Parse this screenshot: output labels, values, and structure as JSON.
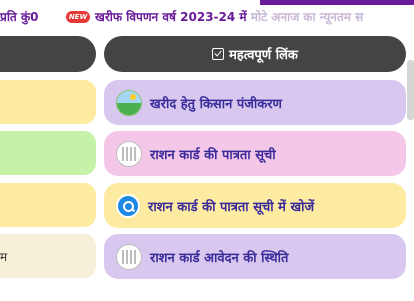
{
  "ticker": {
    "partial_text": "प्रति कुं0",
    "new_badge": "NEW",
    "headline": "खरीफ विपणन वर्ष 2023-24 में ",
    "headline_faded": "मोटे अनाज का न्यूनतम स"
  },
  "left_column": {
    "visible_text_row4": "म"
  },
  "links_section": {
    "header_label": "महत्वपूर्ण लिंक",
    "header_icon": "checkbox-icon",
    "items": [
      {
        "label": "खरीद हेतु किसान पंजीकरण",
        "icon": "farmer-icon",
        "bg": "#d8c8ef"
      },
      {
        "label": "राशन कार्ड की पात्रता सूची",
        "icon": "ration-card-icon",
        "bg": "#f4c6e8"
      },
      {
        "label": "राशन कार्ड की पात्रता सूची में खोजें",
        "icon": "search-icon",
        "bg": "#fdeba1"
      },
      {
        "label": "राशन कार्ड आवेदन की स्थिति",
        "icon": "ration-card-icon",
        "bg": "#d8c8ef"
      }
    ]
  },
  "colors": {
    "header_bg": "#444444",
    "link_text": "#3a2b9a",
    "ticker_text": "#6a1b9a",
    "left_cards": [
      "#fdeba1",
      "#c6f2a7",
      "#fdeba1",
      "#f6f0d8"
    ]
  }
}
